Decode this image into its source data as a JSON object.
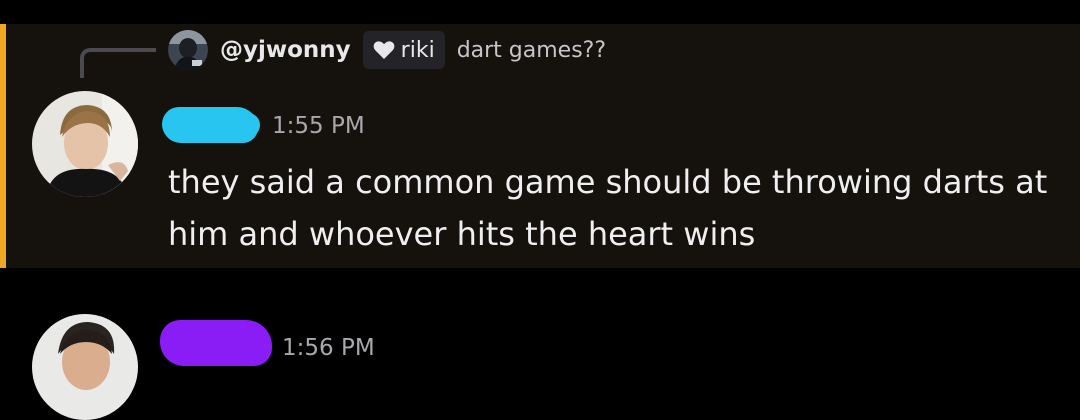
{
  "message": {
    "reply": {
      "username": "@yjwonny",
      "role_tag": "riki",
      "snippet": "dart games??"
    },
    "timestamp": "1:55 PM",
    "text": "they said a common game should be throwing darts at him and whoever hits the heart wins"
  },
  "next_message": {
    "timestamp": "1:56 PM"
  },
  "colors": {
    "mention_bar": "#f0a823",
    "highlight_bg": "#15110c",
    "redaction_blue": "#27c5f0",
    "redaction_purple": "#8a1cf6"
  }
}
